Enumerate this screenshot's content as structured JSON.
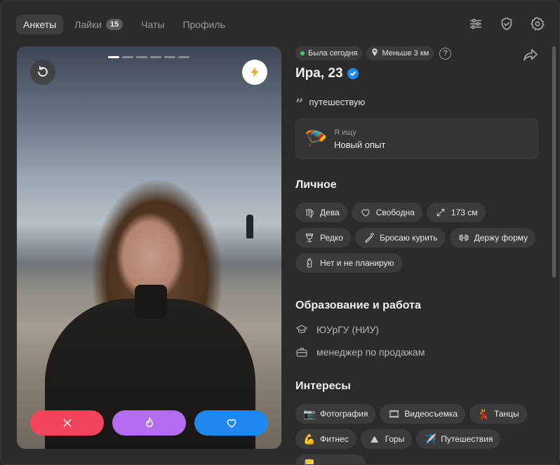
{
  "nav": {
    "tabs": [
      {
        "label": "Анкеты",
        "active": true
      },
      {
        "label": "Лайки",
        "badge": "15"
      },
      {
        "label": "Чаты"
      },
      {
        "label": "Профиль"
      }
    ]
  },
  "photo": {
    "total_photos": 6,
    "current_photo": 1
  },
  "profile": {
    "status": "Была сегодня",
    "distance": "Меньше 3 км",
    "help": "?",
    "name_age": "Ира, 23",
    "verified": true,
    "bio": "путешествую",
    "looking_for": {
      "label": "Я ищу",
      "value": "Новый опыт",
      "icon": "parachute-icon"
    }
  },
  "personal": {
    "title": "Личное",
    "chips": [
      {
        "icon": "virgo-icon",
        "label": "Дева"
      },
      {
        "icon": "heart-icon",
        "label": "Свободна"
      },
      {
        "icon": "height-icon",
        "label": "173 см"
      },
      {
        "icon": "glass-icon",
        "label": "Редко"
      },
      {
        "icon": "cigarette-icon",
        "label": "Бросаю курить"
      },
      {
        "icon": "dumbbell-icon",
        "label": "Держу форму"
      },
      {
        "icon": "baby-bottle-icon",
        "label": "Нет и не планирую"
      }
    ]
  },
  "education": {
    "title": "Образование и работа",
    "university": "ЮУрГУ (НИУ)",
    "job": "менеджер по продажам"
  },
  "interests": {
    "title": "Интересы",
    "chips": [
      {
        "emoji": "📷",
        "label": "Фотография"
      },
      {
        "emoji": "🎞",
        "label": "Видеосъемка"
      },
      {
        "emoji": "💃",
        "label": "Танцы"
      },
      {
        "emoji": "💪",
        "label": "Фитнес"
      },
      {
        "emoji": "⛰",
        "label": "Горы"
      },
      {
        "emoji": "✈️",
        "label": "Путешествия"
      }
    ]
  }
}
